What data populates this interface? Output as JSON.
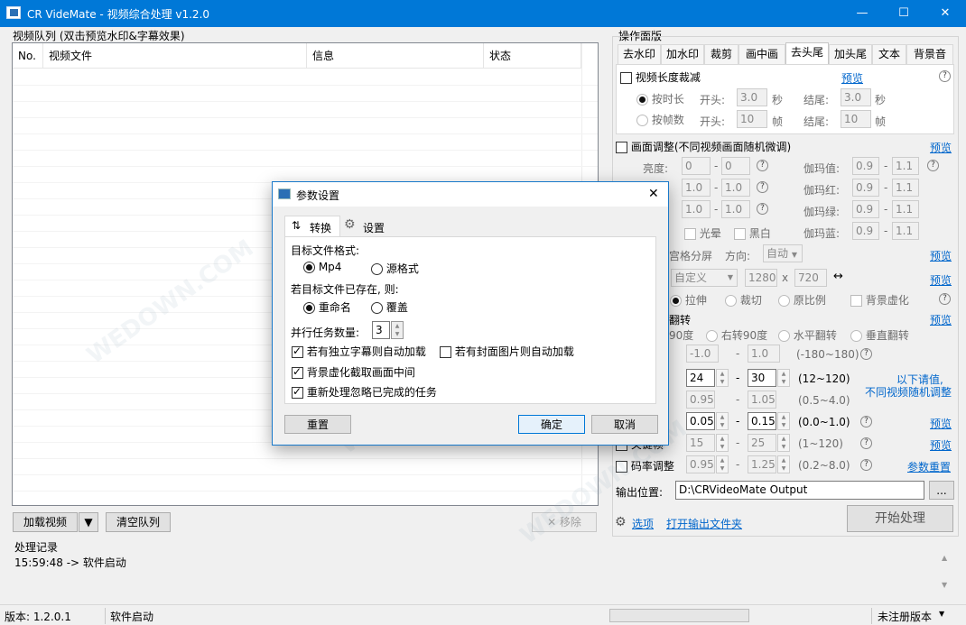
{
  "window": {
    "title": "CR VideMate - 视频综合处理 v1.2.0"
  },
  "queue": {
    "label": "视频队列 (双击预览水印&字幕效果)",
    "columns": [
      "No.",
      "视频文件",
      "信息",
      "状态"
    ],
    "add_button": "加载视频",
    "clear_button": "清空队列",
    "remove_button": "✕ 移除"
  },
  "ops": {
    "label": "操作面版",
    "tabs": [
      "去水印",
      "加水印",
      "裁剪",
      "画中画",
      "去头尾",
      "加头尾",
      "文本",
      "背景音"
    ],
    "active_tab": "去头尾",
    "trim": {
      "title": "视频长度裁减",
      "preview": "预览",
      "by_time": "按时长",
      "by_frame": "按帧数",
      "start": "开头:",
      "end": "结尾:",
      "sec": "秒",
      "frame": "帧",
      "start_time": "3.0",
      "end_time": "3.0",
      "start_frames": "10",
      "end_frames": "10"
    },
    "adjust": {
      "title": "画面调整(不同视频画面随机微调)",
      "preview": "预览",
      "brightness": "亮度:",
      "b1": "0",
      "b2": "0",
      "row2a": "1.0",
      "row2b": "1.0",
      "row3a": "1.0",
      "row3b": "1.0",
      "gamma": "伽玛值:",
      "gamma_red": "伽玛红:",
      "gamma_green": "伽玛绿:",
      "gamma_blue": "伽玛蓝:",
      "g1": "0.9",
      "g2": "1.1",
      "gr1": "0.9",
      "gr2": "1.1",
      "gg1": "0.9",
      "gg2": "1.1",
      "gb1": "0.9",
      "gb2": "1.1",
      "dizzy": "光晕",
      "bw": "黑白"
    },
    "grid": {
      "label": "宫格分屏",
      "direction": "方向:",
      "direction_value": "自动",
      "preview": "预览"
    },
    "size": {
      "preset": "自定义",
      "w": "1280",
      "h": "720",
      "x": "x",
      "preview": "预览"
    },
    "fit": {
      "stretch": "拉伸",
      "crop": "裁切",
      "ratio": "原比例",
      "blur": "背景虚化"
    },
    "rotate": {
      "label": "翻转",
      "preview": "预览",
      "r1": "90度",
      "r2": "右转90度",
      "r3": "水平翻转",
      "r4": "垂直翻转"
    },
    "angle": {
      "a": "-1.0",
      "b": "1.0",
      "range": "(-180~180)"
    },
    "fps": {
      "a": "24",
      "b": "30",
      "range": "(12~120)",
      "note1": "以下请值,",
      "note2": "不同视频随机调整"
    },
    "speed": {
      "a": "0.95",
      "b": "1.05",
      "range": "(0.5~4.0)"
    },
    "blur": {
      "a": "0.05",
      "b": "0.15",
      "range": "(0.0~1.0)",
      "preview": "预览"
    },
    "gop": {
      "label": "关键帧",
      "a": "15",
      "b": "25",
      "range": "(1~120)",
      "preview": "预览"
    },
    "bitrate": {
      "label": "码率调整",
      "a": "0.95",
      "b": "1.25",
      "range": "(0.2~8.0)",
      "reset": "参数重置"
    },
    "output": {
      "label": "输出位置:",
      "path": "D:\\CRVideoMate Output",
      "browse": "..."
    },
    "options": "选项",
    "open_output": "打开输出文件夹",
    "start": "开始处理"
  },
  "log": {
    "label": "处理记录",
    "entry": "15:59:48 -> 软件启动"
  },
  "status": {
    "version": "版本: 1.2.0.1",
    "state": "软件启动",
    "edition": "未注册版本"
  },
  "dialog": {
    "title": "参数设置",
    "tab_convert": "转换",
    "tab_settings": "设置",
    "fmt_label": "目标文件格式:",
    "fmt_mp4": "Mp4",
    "fmt_src": "源格式",
    "exist_label": "若目标文件已存在, 则:",
    "rename": "重命名",
    "overwrite": "覆盖",
    "parallel_label": "并行任务数量:",
    "parallel_value": "3",
    "c1": "若有独立字幕则自动加载",
    "c2": "若有封面图片则自动加载",
    "c3": "背景虚化截取画面中间",
    "c4": "重新处理忽略已完成的任务",
    "reset": "重置",
    "ok": "确定",
    "cancel": "取消"
  }
}
